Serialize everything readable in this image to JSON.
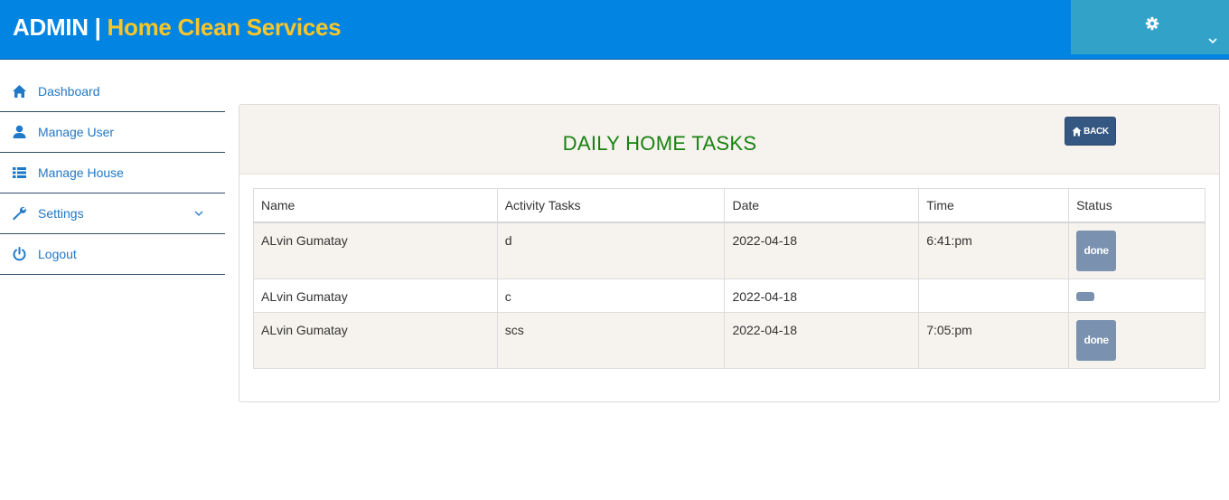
{
  "header": {
    "admin_label": "ADMIN",
    "separator": " | ",
    "app_name": "Home Clean Services",
    "icons": [
      "gear-icon",
      "chevron-down-icon"
    ]
  },
  "sidebar": {
    "items": [
      {
        "label": "Dashboard",
        "icon": "home-icon"
      },
      {
        "label": "Manage User",
        "icon": "user-icon"
      },
      {
        "label": "Manage House",
        "icon": "list-icon"
      },
      {
        "label": "Settings",
        "icon": "wrench-icon",
        "has_submenu": true
      },
      {
        "label": "Logout",
        "icon": "power-icon"
      }
    ]
  },
  "panel": {
    "title": "DAILY HOME TASKS",
    "back_label": "BACK"
  },
  "table": {
    "columns": [
      "Name",
      "Activity Tasks",
      "Date",
      "Time",
      "Status"
    ],
    "rows": [
      {
        "name": "ALvin Gumatay",
        "task": "d",
        "date": "2022-04-18",
        "time": "6:41:pm",
        "status": "done"
      },
      {
        "name": "ALvin Gumatay",
        "task": "c",
        "date": "2022-04-18",
        "time": "",
        "status": ""
      },
      {
        "name": "ALvin Gumatay",
        "task": "scs",
        "date": "2022-04-18",
        "time": "7:05:pm",
        "status": "done"
      }
    ]
  },
  "colors": {
    "topbar": "#0184e2",
    "brand_accent": "#f7c52c",
    "settings_box": "#32a2c9",
    "title_green": "#17820f",
    "back_button": "#355882",
    "status_button": "#7a92b0",
    "nav_link": "#1f78c8"
  }
}
